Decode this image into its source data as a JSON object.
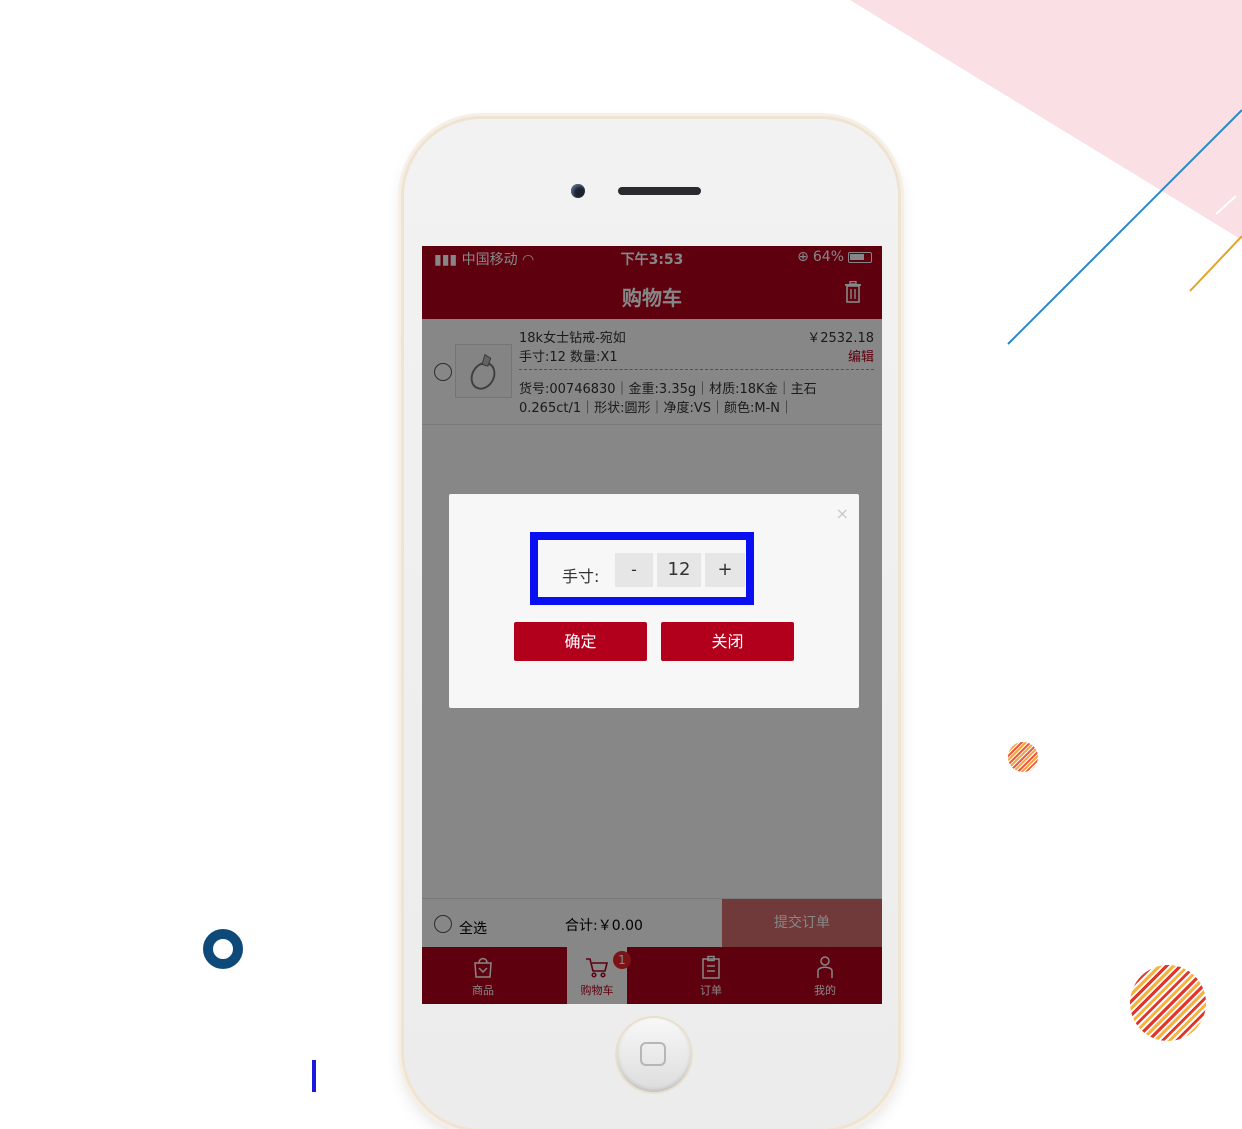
{
  "status_bar": {
    "carrier": "中国移动",
    "time": "下午3:53",
    "battery": "64%"
  },
  "navbar": {
    "title": "购物车",
    "trash_icon": "trash-icon"
  },
  "cart_item": {
    "name": "18k女士钻戒-宛如",
    "price": "￥2532.18",
    "spec": "手寸:12 数量:X1",
    "edit_label": "编辑",
    "details_line1": "货号:00746830｜金重:3.35g｜材质:18K金｜主石",
    "details_line2": "0.265ct/1｜形状:圆形｜净度:VS｜颜色:M-N｜"
  },
  "footer": {
    "select_all": "全选",
    "total": "合计:￥0.00",
    "submit": "提交订单"
  },
  "tabbar": {
    "items": [
      {
        "label": "商品",
        "icon": "shopping-bag-icon"
      },
      {
        "label": "购物车",
        "icon": "cart-icon",
        "badge": "1"
      },
      {
        "label": "订单",
        "icon": "clipboard-icon"
      },
      {
        "label": "我的",
        "icon": "person-icon"
      }
    ]
  },
  "dialog": {
    "close_symbol": "×",
    "size_label": "手寸:",
    "minus": "-",
    "value": "12",
    "plus": "+",
    "confirm": "确定",
    "close": "关闭"
  },
  "colors": {
    "brand": "#b2001c",
    "highlight": "#0a0ff2"
  }
}
